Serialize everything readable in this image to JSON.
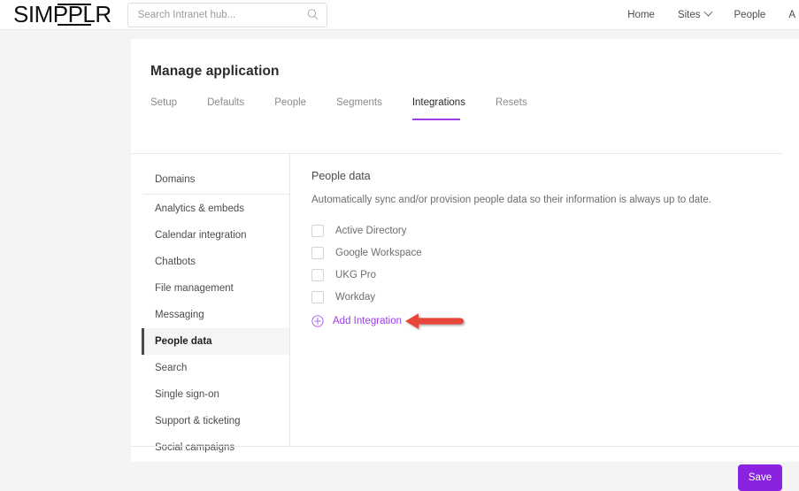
{
  "header": {
    "logo_text": "SIMPPLR",
    "search": {
      "placeholder": "Search Intranet hub...",
      "value": "",
      "icon": "search-icon"
    },
    "nav": [
      {
        "label": "Home",
        "has_chevron": false
      },
      {
        "label": "Sites",
        "has_chevron": true
      },
      {
        "label": "People",
        "has_chevron": false
      },
      {
        "label": "A",
        "has_chevron": false
      }
    ]
  },
  "page": {
    "title": "Manage application"
  },
  "tabs": [
    {
      "label": "Setup",
      "active": false
    },
    {
      "label": "Defaults",
      "active": false
    },
    {
      "label": "People",
      "active": false
    },
    {
      "label": "Segments",
      "active": false
    },
    {
      "label": "Integrations",
      "active": true
    },
    {
      "label": "Resets",
      "active": false
    }
  ],
  "sidebar": {
    "items": [
      {
        "label": "Domains",
        "active": false
      },
      {
        "label": "Analytics & embeds",
        "active": false
      },
      {
        "label": "Calendar integration",
        "active": false
      },
      {
        "label": "Chatbots",
        "active": false
      },
      {
        "label": "File management",
        "active": false
      },
      {
        "label": "Messaging",
        "active": false
      },
      {
        "label": "People data",
        "active": true
      },
      {
        "label": "Search",
        "active": false
      },
      {
        "label": "Single sign-on",
        "active": false
      },
      {
        "label": "Support & ticketing",
        "active": false
      },
      {
        "label": "Social campaigns",
        "active": false
      }
    ]
  },
  "main": {
    "section_title": "People data",
    "description": "Automatically sync and/or provision people data so their information is always up to date.",
    "integrations": [
      {
        "label": "Active Directory",
        "checked": false
      },
      {
        "label": "Google Workspace",
        "checked": false
      },
      {
        "label": "UKG Pro",
        "checked": false
      },
      {
        "label": "Workday",
        "checked": false
      }
    ],
    "add_integration_label": "Add Integration",
    "add_integration_icon": "plus-circle-icon"
  },
  "annotation": {
    "type": "arrow-left",
    "color": "#e8453c",
    "points_to": "Add Integration"
  },
  "footer": {
    "save_label": "Save"
  },
  "colors": {
    "accent_purple": "#9b3de8",
    "save_button": "#8b22e0",
    "annotation_red": "#e8453c",
    "page_background": "#f4f4f4",
    "card_background": "#ffffff"
  }
}
